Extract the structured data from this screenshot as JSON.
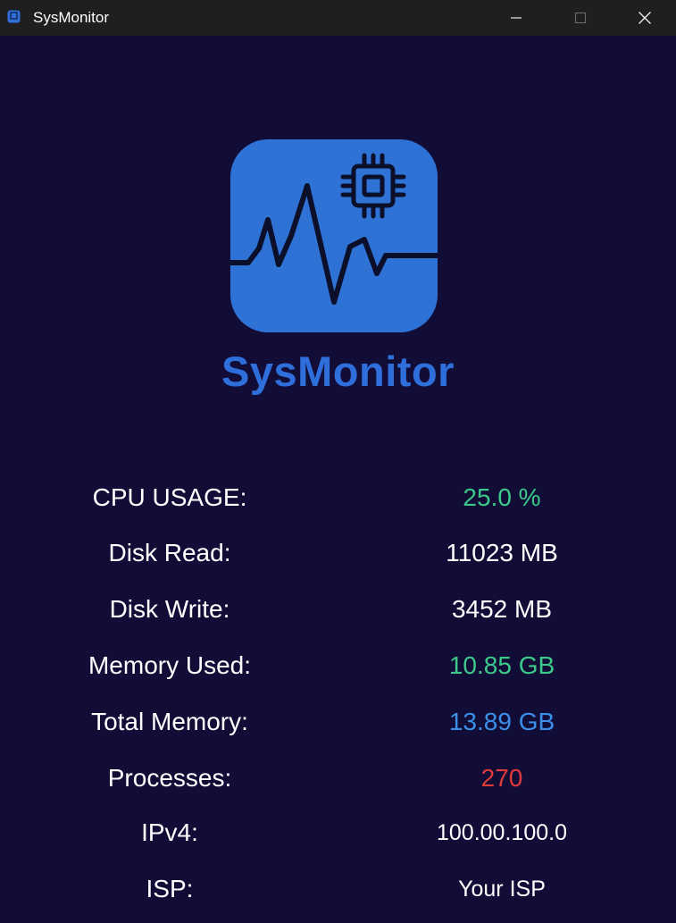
{
  "window": {
    "title": "SysMonitor",
    "controls": [
      "minimize",
      "maximize",
      "close"
    ]
  },
  "brand": {
    "name": "SysMonitor",
    "logo_icon": "heartbeat-chip-icon",
    "brand_color": "#2f6fdc"
  },
  "stats": [
    {
      "label": "CPU USAGE:",
      "value": "25.0 %",
      "color": "#3cc98a"
    },
    {
      "label": "Disk Read:",
      "value": "11023 MB",
      "color": "#ffffff"
    },
    {
      "label": "Disk Write:",
      "value": "3452 MB",
      "color": "#ffffff"
    },
    {
      "label": "Memory Used:",
      "value": "10.85 GB",
      "color": "#3cc98a"
    },
    {
      "label": "Total Memory:",
      "value": "13.89 GB",
      "color": "#3b8fe8"
    },
    {
      "label": "Processes:",
      "value": "270",
      "color": "#e03a3a"
    },
    {
      "label": "IPv4:",
      "value": "100.00.100.0",
      "color": "#ffffff"
    },
    {
      "label": "ISP:",
      "value": "Your ISP",
      "color": "#ffffff"
    }
  ]
}
